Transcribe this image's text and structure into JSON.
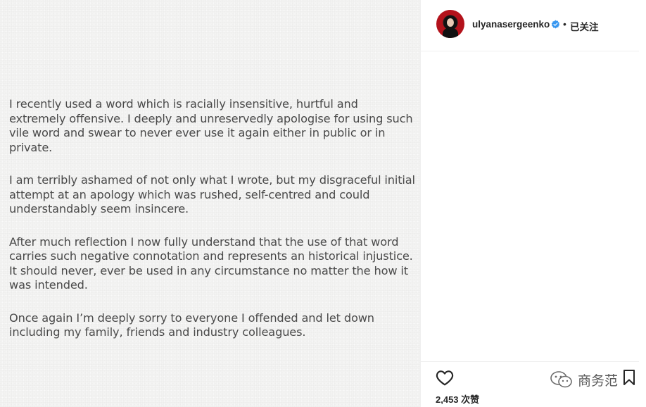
{
  "post": {
    "paragraphs": [
      "I recently used a word which is racially insensitive, hurtful and extremely offensive. I deeply and unreservedly apologise for using such vile word and swear to never ever use it again either in public or in private.",
      "I am terribly ashamed of not only what I wrote, but my disgraceful initial attempt at an apology which was rushed, self-centred and could understandably seem insincere.",
      "After much reflection I now fully understand that the use of that word carries such negative connotation and represents an historical injustice. It should never, ever be used in any circumstance no matter the how it was intended.",
      "Once again I’m deeply sorry to everyone I offended and let down including my family, friends and industry colleagues."
    ]
  },
  "header": {
    "username": "ulyanasergeenko",
    "separator": "•",
    "follow_status": "已关注"
  },
  "actions": {
    "likes_text": "2,453 次赞"
  },
  "watermark": {
    "text": "商务范"
  },
  "colors": {
    "verified": "#3897f0",
    "avatar_bg": "#b3121b"
  },
  "icons": [
    "heart-icon",
    "bookmark-icon",
    "verified-badge-icon",
    "wechat-icon"
  ]
}
